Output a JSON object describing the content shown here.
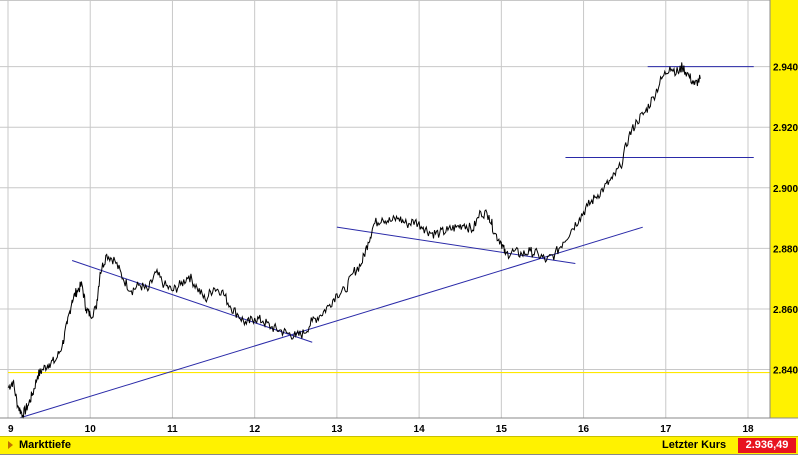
{
  "chart_data": {
    "type": "line",
    "xlim": [
      9,
      18
    ],
    "ylim": [
      2.824,
      2.962
    ],
    "x_ticks": [
      9,
      10,
      11,
      12,
      13,
      14,
      15,
      16,
      17,
      18
    ],
    "x_tick_labels": [
      "9",
      "10",
      "11",
      "12",
      "13",
      "14",
      "15",
      "16",
      "17",
      "18"
    ],
    "y_ticks": [
      2.84,
      2.86,
      2.88,
      2.9,
      2.92,
      2.94
    ],
    "y_tick_labels": [
      "2.840",
      "2.860",
      "2.880",
      "2.900",
      "2.920",
      "2.940"
    ],
    "grid": true,
    "price_axis_side": "right",
    "colors": {
      "price_line": "#000000",
      "trend_lines": "#2a2aa8",
      "reference_line": "#ffe800",
      "axis_panel": "#fff200",
      "grid": "#c8c8c8"
    },
    "series": [
      {
        "values": [
          [
            9.0,
            2.834
          ],
          [
            9.06,
            2.836
          ],
          [
            9.12,
            2.828
          ],
          [
            9.18,
            2.825
          ],
          [
            9.24,
            2.828
          ],
          [
            9.3,
            2.832
          ],
          [
            9.36,
            2.838
          ],
          [
            9.42,
            2.84
          ],
          [
            9.5,
            2.842
          ],
          [
            9.58,
            2.843
          ],
          [
            9.66,
            2.848
          ],
          [
            9.72,
            2.855
          ],
          [
            9.78,
            2.863
          ],
          [
            9.84,
            2.866
          ],
          [
            9.9,
            2.868
          ],
          [
            9.95,
            2.86
          ],
          [
            10.0,
            2.858
          ],
          [
            10.07,
            2.86
          ],
          [
            10.12,
            2.872
          ],
          [
            10.2,
            2.878
          ],
          [
            10.3,
            2.876
          ],
          [
            10.4,
            2.87
          ],
          [
            10.5,
            2.866
          ],
          [
            10.6,
            2.868
          ],
          [
            10.7,
            2.866
          ],
          [
            10.8,
            2.872
          ],
          [
            10.9,
            2.868
          ],
          [
            11.0,
            2.866
          ],
          [
            11.1,
            2.868
          ],
          [
            11.2,
            2.871
          ],
          [
            11.3,
            2.867
          ],
          [
            11.4,
            2.863
          ],
          [
            11.5,
            2.867
          ],
          [
            11.6,
            2.866
          ],
          [
            11.7,
            2.861
          ],
          [
            11.8,
            2.858
          ],
          [
            11.9,
            2.855
          ],
          [
            12.0,
            2.857
          ],
          [
            12.1,
            2.856
          ],
          [
            12.2,
            2.854
          ],
          [
            12.3,
            2.853
          ],
          [
            12.4,
            2.852
          ],
          [
            12.5,
            2.851
          ],
          [
            12.6,
            2.852
          ],
          [
            12.7,
            2.856
          ],
          [
            12.8,
            2.858
          ],
          [
            12.9,
            2.861
          ],
          [
            13.0,
            2.865
          ],
          [
            13.1,
            2.866
          ],
          [
            13.2,
            2.872
          ],
          [
            13.3,
            2.875
          ],
          [
            13.38,
            2.882
          ],
          [
            13.45,
            2.888
          ],
          [
            13.55,
            2.89
          ],
          [
            13.65,
            2.889
          ],
          [
            13.75,
            2.89
          ],
          [
            13.85,
            2.888
          ],
          [
            13.95,
            2.889
          ],
          [
            14.05,
            2.887
          ],
          [
            14.15,
            2.885
          ],
          [
            14.25,
            2.885
          ],
          [
            14.35,
            2.886
          ],
          [
            14.45,
            2.887
          ],
          [
            14.55,
            2.888
          ],
          [
            14.65,
            2.886
          ],
          [
            14.75,
            2.892
          ],
          [
            14.85,
            2.891
          ],
          [
            14.92,
            2.885
          ],
          [
            15.0,
            2.882
          ],
          [
            15.05,
            2.878
          ],
          [
            15.15,
            2.879
          ],
          [
            15.25,
            2.878
          ],
          [
            15.35,
            2.879
          ],
          [
            15.45,
            2.878
          ],
          [
            15.55,
            2.876
          ],
          [
            15.65,
            2.878
          ],
          [
            15.75,
            2.882
          ],
          [
            15.85,
            2.886
          ],
          [
            15.95,
            2.89
          ],
          [
            16.05,
            2.894
          ],
          [
            16.15,
            2.897
          ],
          [
            16.25,
            2.9
          ],
          [
            16.35,
            2.903
          ],
          [
            16.45,
            2.907
          ],
          [
            16.55,
            2.917
          ],
          [
            16.65,
            2.922
          ],
          [
            16.75,
            2.925
          ],
          [
            16.85,
            2.93
          ],
          [
            16.95,
            2.936
          ],
          [
            17.05,
            2.94
          ],
          [
            17.15,
            2.938
          ],
          [
            17.2,
            2.94
          ],
          [
            17.28,
            2.937
          ],
          [
            17.35,
            2.934
          ],
          [
            17.42,
            2.936
          ]
        ]
      }
    ],
    "horizontal_lines": [
      {
        "y": 2.94,
        "x_from": 16.78,
        "x_to": 18.07,
        "style": "trend"
      },
      {
        "y": 2.91,
        "x_from": 15.78,
        "x_to": 18.07,
        "style": "trend"
      },
      {
        "y": 2.839,
        "x_from": 9.0,
        "x_to": 18.3,
        "style": "reference"
      }
    ],
    "trend_lines": [
      {
        "from": [
          9.14,
          2.824
        ],
        "to": [
          16.72,
          2.887
        ]
      },
      {
        "from": [
          9.78,
          2.876
        ],
        "to": [
          12.7,
          2.849
        ]
      },
      {
        "from": [
          13.0,
          2.887
        ],
        "to": [
          15.9,
          2.875
        ]
      }
    ]
  },
  "footer": {
    "left_label": "Markttiefe",
    "right_label": "Letzter Kurs",
    "last_price": "2.936,49"
  }
}
